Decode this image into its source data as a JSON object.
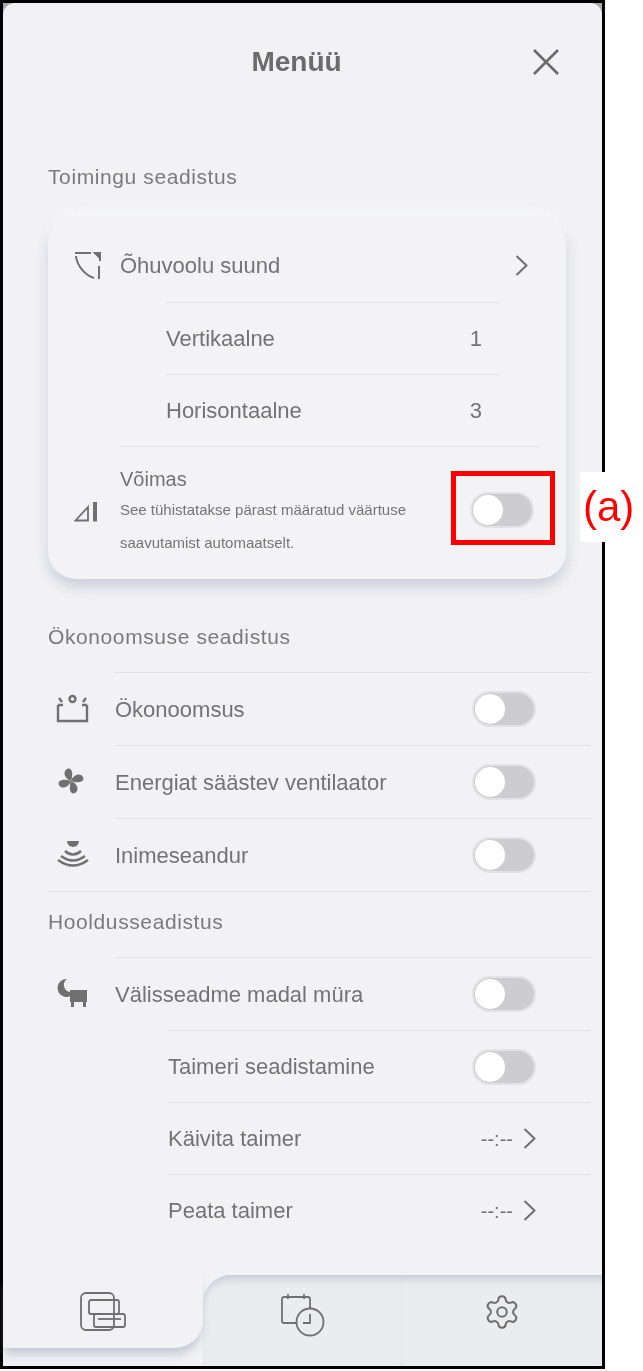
{
  "header": {
    "title": "Menüü"
  },
  "sections": [
    {
      "title": "Toimingu seadistus",
      "kind": "card",
      "rows": [
        {
          "kind": "link",
          "label": "Õhuvoolu suund",
          "children": [
            {
              "kind": "value",
              "label": "Vertikaalne",
              "value": "1"
            },
            {
              "kind": "value",
              "label": "Horisontaalne",
              "value": "3"
            }
          ]
        },
        {
          "kind": "toggle",
          "label": "Võimas",
          "note": "See tühistatakse pärast määratud väärtuse saavutamist automaatselt.",
          "on": false,
          "annotation": "(a)"
        }
      ]
    },
    {
      "title": "Ökonoomsuse seadistus",
      "kind": "list",
      "rows": [
        {
          "kind": "toggle",
          "label": "Ökonoomsus",
          "on": false
        },
        {
          "kind": "toggle",
          "label": "Energiat säästev ventilaator",
          "on": false
        },
        {
          "kind": "toggle",
          "label": "Inimeseandur",
          "on": false
        }
      ]
    },
    {
      "title": "Hooldusseadistus",
      "kind": "list",
      "rows": [
        {
          "kind": "toggle",
          "label": "Välisseadme madal müra",
          "on": false,
          "children": [
            {
              "kind": "toggle",
              "label": "Taimeri seadistamine",
              "on": false
            },
            {
              "kind": "timer",
              "label": "Käivita taimer",
              "value": "--:--"
            },
            {
              "kind": "timer",
              "label": "Peata taimer",
              "value": "--:--"
            }
          ]
        }
      ]
    }
  ],
  "tab_bar": {
    "tabs": [
      {
        "kind": "units",
        "selected": true
      },
      {
        "kind": "schedule",
        "selected": false
      },
      {
        "kind": "settings",
        "selected": false
      }
    ]
  }
}
